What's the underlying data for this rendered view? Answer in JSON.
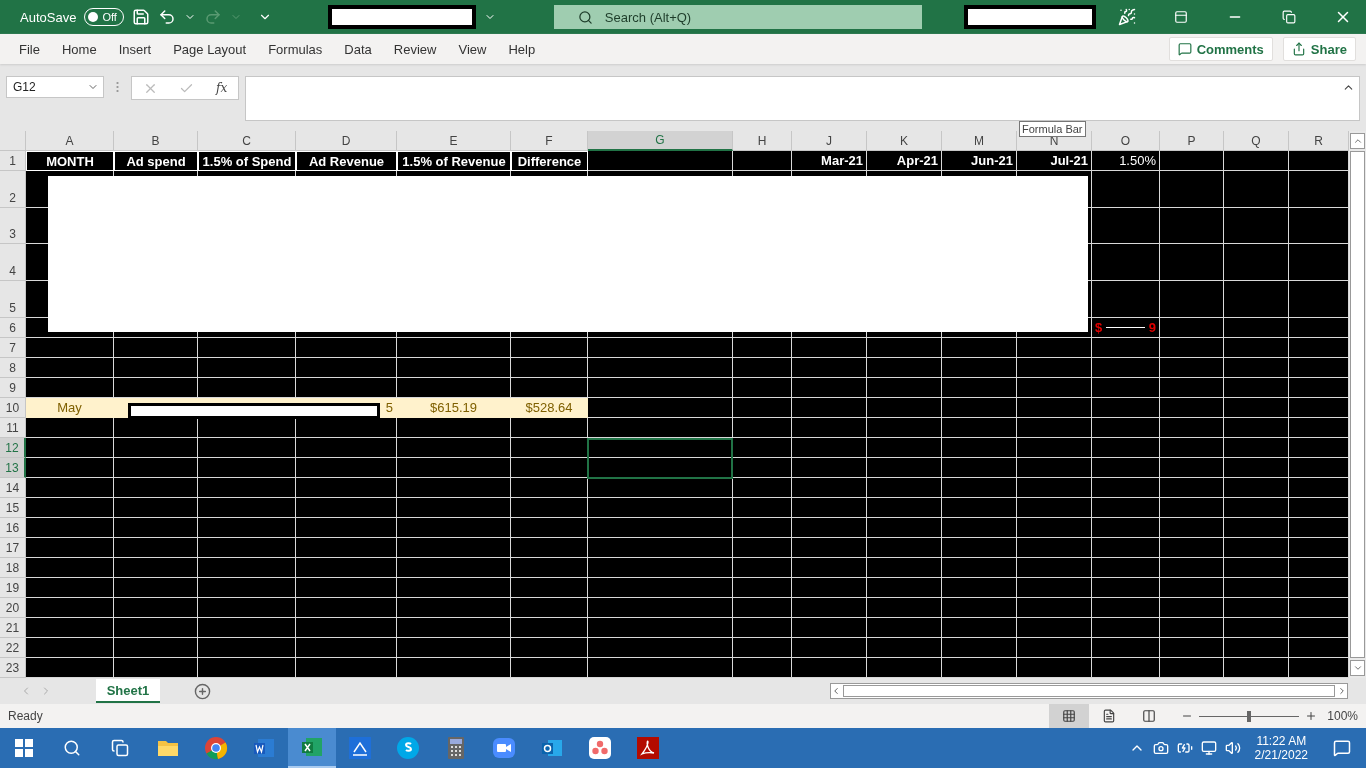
{
  "title_bar": {
    "autosave": {
      "label": "AutoSave",
      "state": "Off",
      "on": false
    },
    "search": {
      "placeholder": "Search (Alt+Q)"
    }
  },
  "menu": {
    "tabs": [
      "File",
      "Home",
      "Insert",
      "Page Layout",
      "Formulas",
      "Data",
      "Review",
      "View",
      "Help"
    ],
    "buttons": [
      "Comments",
      "Share"
    ]
  },
  "formula_bar": {
    "name_box": "G12",
    "function_label": "fx",
    "tooltip": "Formula Bar"
  },
  "sheet": {
    "columns": [
      {
        "label": "A",
        "selected": false
      },
      {
        "label": "B",
        "selected": false
      },
      {
        "label": "C",
        "selected": false
      },
      {
        "label": "D",
        "selected": false
      },
      {
        "label": "E",
        "selected": false
      },
      {
        "label": "F",
        "selected": false
      },
      {
        "label": "G",
        "selected": true
      },
      {
        "label": "H",
        "selected": false
      },
      {
        "label": "J",
        "selected": false
      },
      {
        "label": "K",
        "selected": false
      },
      {
        "label": "M",
        "selected": false
      },
      {
        "label": "N",
        "selected": false
      },
      {
        "label": "O",
        "selected": false
      },
      {
        "label": "P",
        "selected": false
      },
      {
        "label": "Q",
        "selected": false
      },
      {
        "label": "R",
        "selected": false
      }
    ],
    "rows": [
      {
        "label": "1",
        "selected": false,
        "cells": [
          {
            "text": "MONTH",
            "kind": "heading"
          },
          {
            "text": "Ad spend",
            "kind": "heading"
          },
          {
            "text": "1.5% of Spend",
            "kind": "heading"
          },
          {
            "text": "Ad Revenue",
            "kind": "heading"
          },
          {
            "text": "1.5% of Revenue",
            "kind": "heading"
          },
          {
            "text": "Difference",
            "kind": "heading"
          },
          null,
          null,
          {
            "text": "Mar-21",
            "kind": "date"
          },
          {
            "text": "Apr-21",
            "kind": "date"
          },
          {
            "text": "Jun-21",
            "kind": "date"
          },
          {
            "text": "Jul-21",
            "kind": "date"
          },
          {
            "text": "1.50%",
            "kind": "number"
          },
          null,
          null,
          null
        ]
      },
      {
        "label": "2",
        "selected": false
      },
      {
        "label": "3",
        "selected": false
      },
      {
        "label": "4",
        "selected": false
      },
      {
        "label": "5",
        "selected": false
      },
      {
        "label": "6",
        "selected": false,
        "cells": [
          null,
          null,
          null,
          null,
          null,
          null,
          null,
          null,
          null,
          null,
          null,
          null,
          {
            "text": "$",
            "suffix": "9",
            "kind": "negative"
          },
          null,
          null,
          null
        ]
      },
      {
        "label": "7",
        "selected": false
      },
      {
        "label": "8",
        "selected": false
      },
      {
        "label": "9",
        "selected": false
      },
      {
        "label": "10",
        "selected": false,
        "cells": [
          {
            "text": "May",
            "kind": "highlight"
          },
          {
            "kind": "highlight"
          },
          {
            "kind": "highlight"
          },
          {
            "text": "5",
            "kind": "highlight-right"
          },
          {
            "text": "$615.19",
            "kind": "highlight"
          },
          {
            "text": "$528.64",
            "kind": "highlight"
          },
          null,
          null,
          null,
          null,
          null,
          null,
          null,
          null,
          null,
          null
        ]
      },
      {
        "label": "11",
        "selected": false
      },
      {
        "label": "12",
        "selected": true
      },
      {
        "label": "13",
        "selected": true
      },
      {
        "label": "14",
        "selected": false
      },
      {
        "label": "15",
        "selected": false
      },
      {
        "label": "16",
        "selected": false
      },
      {
        "label": "17",
        "selected": false
      },
      {
        "label": "18",
        "selected": false
      },
      {
        "label": "19",
        "selected": false
      },
      {
        "label": "20",
        "selected": false
      },
      {
        "label": "21",
        "selected": false
      },
      {
        "label": "22",
        "selected": false
      },
      {
        "label": "23",
        "selected": false
      }
    ]
  },
  "sheet_tabs": [
    {
      "label": "Sheet1",
      "selected": true
    }
  ],
  "status_bar": {
    "status": "Ready",
    "views": [
      {
        "selected": true
      },
      {
        "selected": false
      },
      {
        "selected": false
      }
    ],
    "zoom": {
      "level": 0.5,
      "reading": "100%"
    }
  },
  "taskbar": {
    "apps": [
      {
        "kind": "folder",
        "active": false
      },
      {
        "kind": "chrome",
        "active": false
      },
      {
        "kind": "word",
        "active": false
      },
      {
        "kind": "excel",
        "active": true
      },
      {
        "kind": "scan",
        "active": false
      },
      {
        "kind": "skype",
        "active": false
      },
      {
        "kind": "calculator",
        "active": false
      },
      {
        "kind": "video",
        "active": false
      },
      {
        "kind": "outlook",
        "active": false
      },
      {
        "kind": "dots",
        "active": false
      },
      {
        "kind": "acrobat",
        "active": false
      }
    ],
    "time": "11:22 AM",
    "date": "2/21/2022"
  }
}
